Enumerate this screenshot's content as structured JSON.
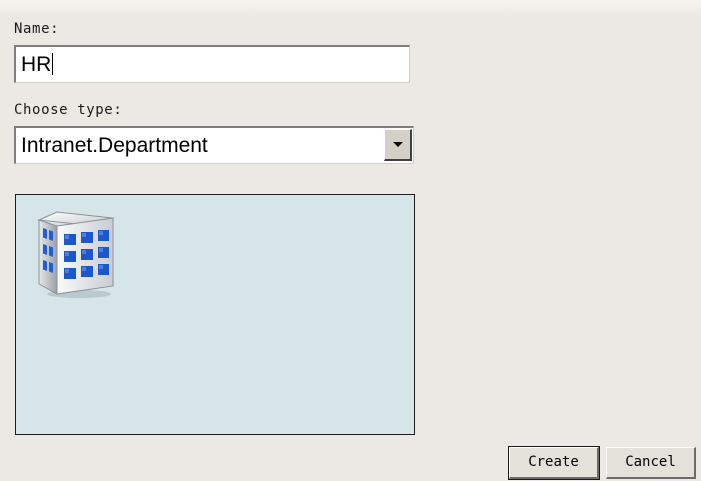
{
  "form": {
    "name_label": "Name:",
    "name_value": "HR",
    "type_label": "Choose type:",
    "type_value": "Intranet.Department"
  },
  "preview": {
    "icon": "building-icon"
  },
  "buttons": {
    "create_label": "Create",
    "cancel_label": "Cancel"
  },
  "colors": {
    "background": "#ece9e4",
    "preview_background": "#d5e5e8",
    "window_blue": "#1f5fd6"
  }
}
